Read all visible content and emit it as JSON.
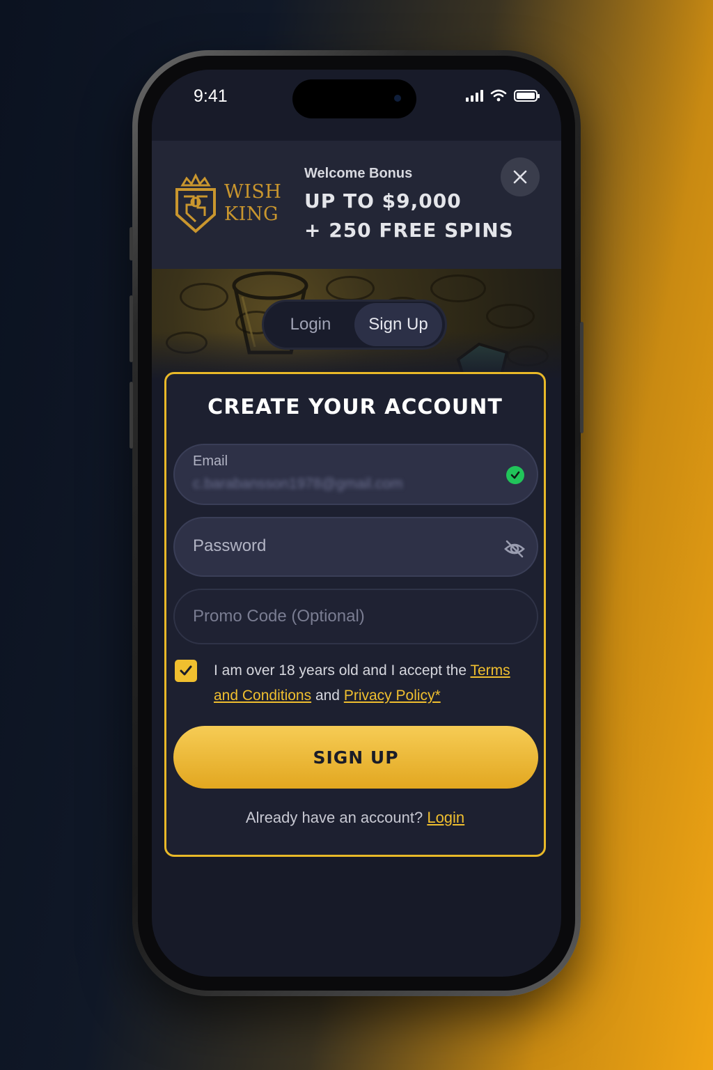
{
  "status_bar": {
    "time": "9:41"
  },
  "brand": {
    "line1": "WISH",
    "line2": "KING"
  },
  "bonus": {
    "title": "Welcome Bonus",
    "line1": "UP TO $9,000",
    "line2": "+ 250 FREE SPINS"
  },
  "tabs": [
    {
      "label": "Login",
      "active": false
    },
    {
      "label": "Sign Up",
      "active": true
    }
  ],
  "form": {
    "title": "CREATE YOUR ACCOUNT",
    "email": {
      "label": "Email",
      "value": "c.barabansson1978@gmail.com",
      "status": "valid"
    },
    "password": {
      "placeholder": "Password"
    },
    "promo": {
      "placeholder": "Promo Code (Optional)"
    },
    "consent": {
      "checked": true,
      "text_before": "I am over 18 years old and I accept the ",
      "terms_link": "Terms and Conditions",
      "text_mid": " and ",
      "privacy_link": "Privacy Policy*"
    },
    "submit_label": "SIGN UP",
    "footer_text": "Already have an account? ",
    "footer_link": "Login"
  },
  "colors": {
    "accent": "#f0bf2f",
    "card_border": "#e9b928",
    "success": "#21c45a",
    "background": "#171a28"
  },
  "icons": [
    "close-icon",
    "check-circle-icon",
    "eye-off-icon",
    "checkmark-icon",
    "signal-icon",
    "wifi-icon",
    "battery-icon"
  ]
}
